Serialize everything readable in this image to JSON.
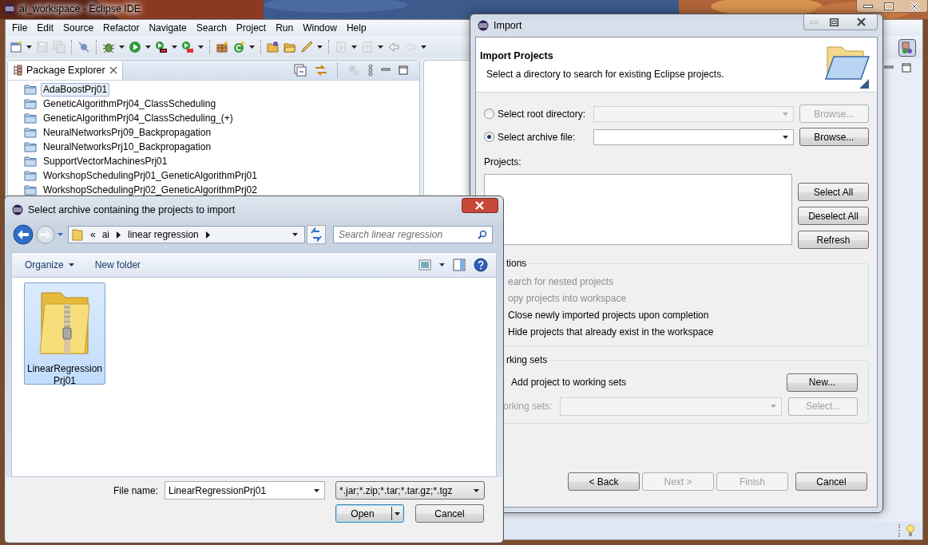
{
  "main_window": {
    "title": "ai_workspace - Eclipse IDE",
    "menu": [
      "File",
      "Edit",
      "Source",
      "Refactor",
      "Navigate",
      "Search",
      "Project",
      "Run",
      "Window",
      "Help"
    ],
    "package_explorer": {
      "title": "Package Explorer",
      "items": [
        {
          "label": "AdaBoostPrj01",
          "selected": true
        },
        {
          "label": "GeneticAlgorithmPrj04_ClassScheduling",
          "selected": false
        },
        {
          "label": "GeneticAlgorithmPrj04_ClassScheduling_(+)",
          "selected": false
        },
        {
          "label": "NeuralNetworksPrj09_Backpropagation",
          "selected": false
        },
        {
          "label": "NeuralNetworksPrj10_Backpropagation",
          "selected": false
        },
        {
          "label": "SupportVectorMachinesPrj01",
          "selected": false
        },
        {
          "label": "WorkshopSchedulingPrj01_GeneticAlgorithmPrj01",
          "selected": false
        },
        {
          "label": "WorkshopSchedulingPrj02_GeneticAlgorithmPrj02",
          "selected": false
        }
      ]
    }
  },
  "import_dialog": {
    "title": "Import",
    "heading": "Import Projects",
    "description": "Select a directory to search for existing Eclipse projects.",
    "source_options": [
      {
        "label": "Select root directory:",
        "selected": false,
        "disabled": true,
        "button": "Browse..."
      },
      {
        "label": "Select archive file:",
        "selected": true,
        "disabled": false,
        "button": "Browse..."
      }
    ],
    "projects_label": "Projects:",
    "list_buttons": [
      "Select All",
      "Deselect All",
      "Refresh"
    ],
    "options_group": {
      "title": "tions",
      "options": [
        {
          "label": "earch for nested projects",
          "disabled": true
        },
        {
          "label": "opy projects into workspace",
          "disabled": true
        },
        {
          "label": "Close newly imported projects upon completion",
          "disabled": false
        },
        {
          "label": "Hide projects that already exist in the workspace",
          "disabled": false
        }
      ]
    },
    "working_sets_group": {
      "title": "rking sets",
      "add_label": "Add project to working sets",
      "new_button": "New...",
      "sets_label": "orking sets:",
      "select_button": "Select...",
      "sets_disabled": true
    },
    "footer_buttons": [
      {
        "label": "< Back",
        "disabled": false
      },
      {
        "label": "Next >",
        "disabled": true
      },
      {
        "label": "Finish",
        "disabled": true
      },
      {
        "label": "Cancel",
        "disabled": false
      }
    ]
  },
  "file_dialog": {
    "title": "Select archive containing the projects to import",
    "breadcrumb": {
      "overflow": "«",
      "segments": [
        "ai",
        "linear regression"
      ]
    },
    "search": {
      "placeholder": "Search linear regression"
    },
    "toolbar": [
      "Organize",
      "New folder"
    ],
    "files": [
      {
        "label": "LinearRegression\nPrj01",
        "selected": true
      }
    ],
    "file_name_label": "File name:",
    "file_name": "LinearRegressionPrj01",
    "filter": "*.jar;*.zip;*.tar;*.tar.gz;*.tgz",
    "buttons": [
      {
        "label": "Open",
        "kind": "split",
        "default": true
      },
      {
        "label": "Cancel",
        "kind": "plain",
        "default": false
      }
    ]
  }
}
